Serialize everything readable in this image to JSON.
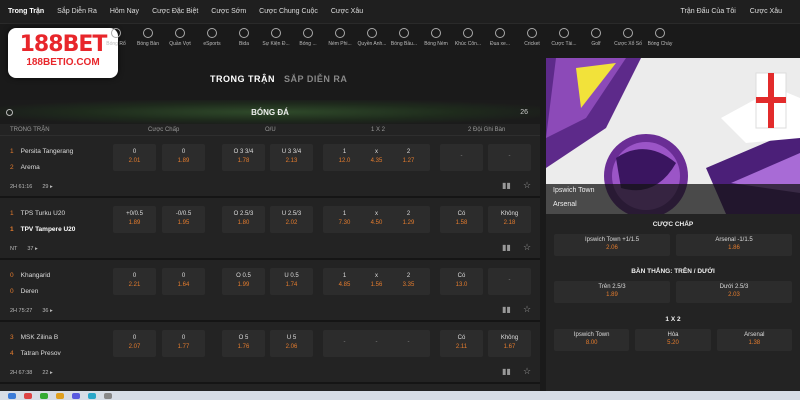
{
  "topnav": {
    "links": [
      "Trong Trận",
      "Sắp Diễn Ra",
      "Hôm Nay",
      "Cược Đặc Biệt",
      "Cược Sớm",
      "Cược Chung Cuộc",
      "Cược Xâu"
    ],
    "right": [
      "Trận Đấu Của Tôi",
      "Cược Xâu"
    ]
  },
  "logo": {
    "brand_num": "188",
    "brand_word": "BET",
    "site": "188BETIO.COM"
  },
  "sports": [
    "Bóng Rổ",
    "Bóng Bàn",
    "Quần Vợt",
    "eSports",
    "Bida",
    "Sự Kiện Đ...",
    "Bóng ...",
    "Ném Phi...",
    "Quyền Anh...",
    "Bóng Bầu...",
    "Bóng Ném",
    "Khúc Côn...",
    "Đua xe...",
    "Cricket",
    "Cược Tài...",
    "Golf",
    "Cược Xổ Số",
    "Bóng Chày"
  ],
  "tabs": {
    "live": "TRONG TRẬN",
    "upcoming": "SẮP DIỄN RA"
  },
  "section": {
    "title": "BÓNG ĐÁ",
    "count": "26"
  },
  "columns": {
    "match": "TRONG TRẬN",
    "handicap": "Cược Chấp",
    "ou": "O/U",
    "x12": "1 X 2",
    "btts": "2 Đội Ghi Bàn"
  },
  "matches": [
    {
      "home": "Persita Tangerang",
      "away": "Arema",
      "home_n": "1",
      "away_n": "2",
      "time": "2H 61:16",
      "more": "29 ▸",
      "cells": [
        {
          "l": "0",
          "v": "2.01"
        },
        {
          "l": "0",
          "v": "1.89"
        },
        {
          "l": "O 3 3/4",
          "v": "1.78"
        },
        {
          "l": "U 3 3/4",
          "v": "2.13"
        },
        {
          "l": "1",
          "v": "12.0"
        },
        {
          "l": "x",
          "v": "4.35"
        },
        {
          "l": "2",
          "v": "1.27"
        },
        {
          "l": "-",
          "v": ""
        },
        {
          "l": "-",
          "v": ""
        }
      ]
    },
    {
      "home": "TPS Turku U20",
      "away": "TPV Tampere U20",
      "home_n": "1",
      "away_n": "1",
      "time": "NT",
      "more": "37 ▸",
      "cells": [
        {
          "l": "+0/0.5",
          "v": "1.89"
        },
        {
          "l": "-0/0.5",
          "v": "1.95"
        },
        {
          "l": "O 2.5/3",
          "v": "1.80"
        },
        {
          "l": "U 2.5/3",
          "v": "2.02"
        },
        {
          "l": "1",
          "v": "7.30"
        },
        {
          "l": "x",
          "v": "4.50"
        },
        {
          "l": "2",
          "v": "1.29"
        },
        {
          "l": "Có",
          "v": "1.58"
        },
        {
          "l": "Không",
          "v": "2.18"
        }
      ]
    },
    {
      "home": "Khangarid",
      "away": "Deren",
      "home_n": "0",
      "away_n": "0",
      "time": "2H 75:27",
      "more": "36 ▸",
      "cells": [
        {
          "l": "0",
          "v": "2.21"
        },
        {
          "l": "0",
          "v": "1.64"
        },
        {
          "l": "O 0.5",
          "v": "1.99"
        },
        {
          "l": "U 0.5",
          "v": "1.74"
        },
        {
          "l": "1",
          "v": "4.85"
        },
        {
          "l": "x",
          "v": "1.56"
        },
        {
          "l": "2",
          "v": "3.35"
        },
        {
          "l": "Có",
          "v": "13.0"
        },
        {
          "l": "-",
          "v": ""
        }
      ]
    },
    {
      "home": "MSK Zilina B",
      "away": "Tatran Presov",
      "home_n": "3",
      "away_n": "4",
      "time": "2H 67:38",
      "more": "22 ▸",
      "cells": [
        {
          "l": "0",
          "v": "2.07"
        },
        {
          "l": "0",
          "v": "1.77"
        },
        {
          "l": "O 5",
          "v": "1.76"
        },
        {
          "l": "U 5",
          "v": "2.06"
        },
        {
          "l": "-",
          "v": ""
        },
        {
          "l": "-",
          "v": ""
        },
        {
          "l": "-",
          "v": ""
        },
        {
          "l": "Có",
          "v": "2.11"
        },
        {
          "l": "Không",
          "v": "1.67"
        }
      ]
    }
  ],
  "featured": {
    "home": "Ipswich Town",
    "away": "Arsenal",
    "handicap_title": "CƯỢC CHẤP",
    "handicap": [
      {
        "l": "Ipswich Town +1/1.5",
        "v": "2.06"
      },
      {
        "l": "Arsenal -1/1.5",
        "v": "1.86"
      }
    ],
    "ou_title": "BÀN THẮNG: TRÊN / DƯỚI",
    "ou": [
      {
        "l": "Trên 2.5/3",
        "v": "1.89"
      },
      {
        "l": "Dưới 2.5/3",
        "v": "2.03"
      }
    ],
    "x12_title": "1 X 2",
    "x12": [
      {
        "l": "Ipswich Town",
        "v": "8.00"
      },
      {
        "l": "Hòa",
        "v": "5.20"
      },
      {
        "l": "Arsenal",
        "v": "1.38"
      }
    ]
  }
}
